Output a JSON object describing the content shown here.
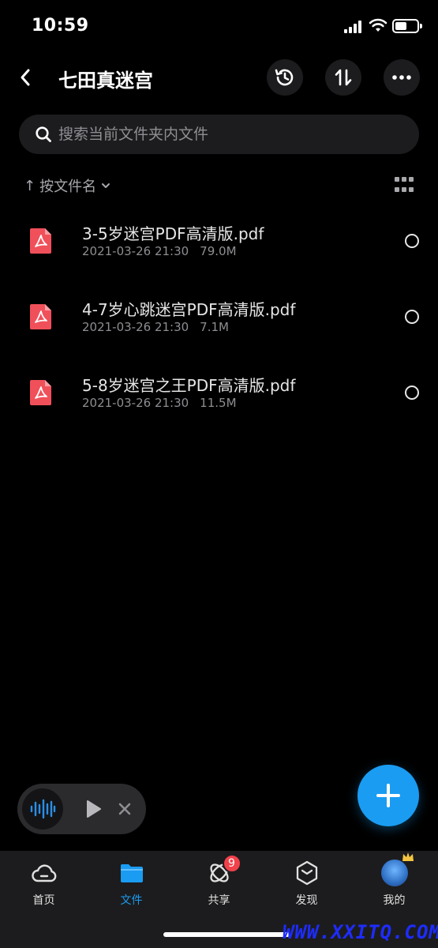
{
  "status_bar": {
    "time": "10:59",
    "icons": [
      "signal-icon",
      "wifi-icon",
      "battery-icon"
    ]
  },
  "header": {
    "title": "七田真迷宫",
    "icons": [
      "back-icon",
      "history-icon",
      "sort-swap-icon",
      "more-icon"
    ]
  },
  "search": {
    "placeholder": "搜索当前文件夹内文件",
    "value": ""
  },
  "sort": {
    "label": "按文件名",
    "arrow": "↑",
    "icons": [
      "chevron-down-icon",
      "grid-view-icon"
    ]
  },
  "files": [
    {
      "name": "3-5岁迷宫PDF高清版.pdf",
      "date": "2021-03-26 21:30",
      "size": "79.0M",
      "icon": "pdf-icon"
    },
    {
      "name": "4-7岁心跳迷宫PDF高清版.pdf",
      "date": "2021-03-26 21:30",
      "size": "7.1M",
      "icon": "pdf-icon"
    },
    {
      "name": "5-8岁迷宫之王PDF高清版.pdf",
      "date": "2021-03-26 21:30",
      "size": "11.5M",
      "icon": "pdf-icon"
    }
  ],
  "player": {
    "icons": [
      "audio-wave-icon",
      "play-icon",
      "close-icon"
    ]
  },
  "fab": {
    "icon": "plus-icon"
  },
  "tabs": [
    {
      "label": "首页",
      "icon": "cloud-home-icon",
      "active": false
    },
    {
      "label": "文件",
      "icon": "folder-icon",
      "active": true
    },
    {
      "label": "共享",
      "icon": "share-orbit-icon",
      "active": false,
      "badge": "9"
    },
    {
      "label": "发现",
      "icon": "discover-cube-icon",
      "active": false
    },
    {
      "label": "我的",
      "icon": "avatar-icon",
      "active": false
    }
  ],
  "watermark": "WWW.XXITQ.COM",
  "colors": {
    "accent": "#1a9cf2",
    "pdf": "#f0505a",
    "badge": "#f1414b",
    "background": "#000000",
    "tab_bar": "#1c1c1e"
  }
}
